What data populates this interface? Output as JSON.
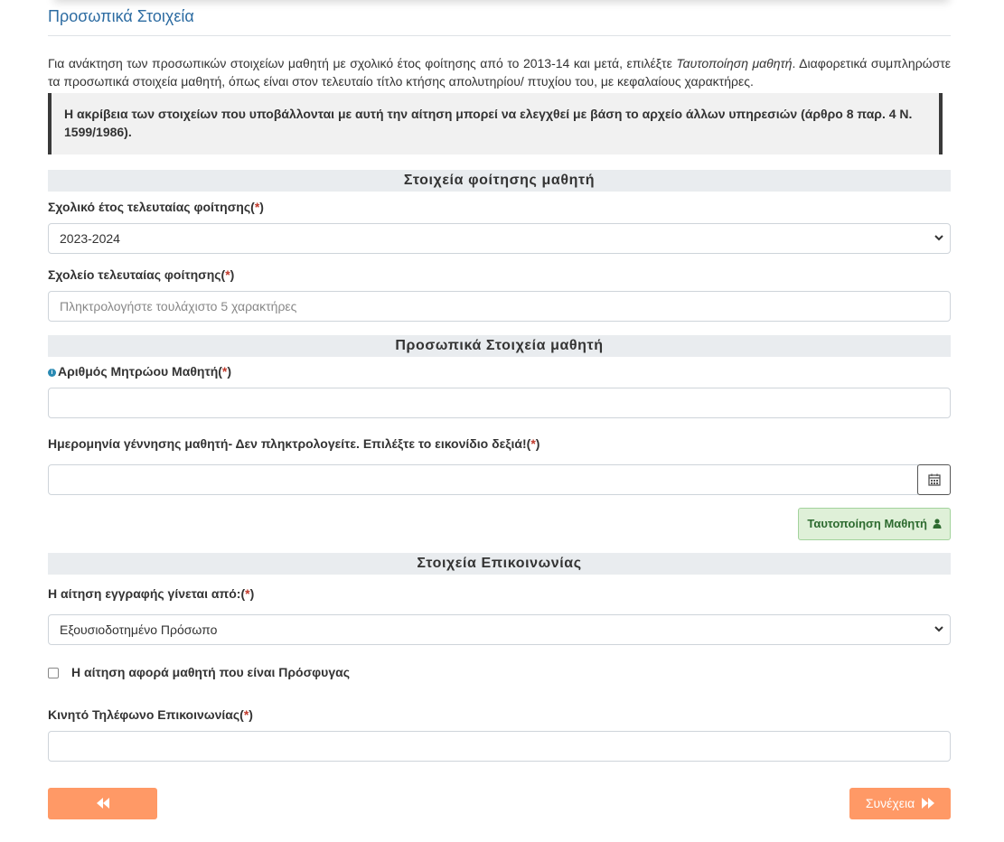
{
  "page": {
    "title": "Προσωπικά Στοιχεία",
    "intro_text_1": "Για ανάκτηση των προσωπικών στοιχείων μαθητή με σχολικό έτος φοίτησης από το 2013-14 και μετά, επιλέξτε ",
    "intro_emphasis": "Ταυτοποίηση μαθητή",
    "intro_text_2": ". Διαφορετικά συμπληρώστε τα προσωπικά στοιχεία μαθητή, όπως είναι στον τελευταίο τίτλο κτήσης απολυτηρίου/ πτυχίου του, με κεφαλαίους χαρακτήρες.",
    "notice": "Η ακρίβεια των στοιχείων που υποβάλλονται με αυτή την αίτηση μπορεί να ελεγχθεί με βάση το αρχείο άλλων υπηρεσιών (άρθρο 8 παρ. 4 Ν. 1599/1986)."
  },
  "attendance": {
    "heading": "Στοιχεία φοίτησης μαθητή",
    "year_label": "Σχολικό έτος τελευταίας φοίτησης",
    "year_value": "2023-2024",
    "school_label": "Σχολείο τελευταίας φοίτησης",
    "school_placeholder": "Πληκτρολογήστε τουλάχιστο 5 χαρακτήρες"
  },
  "personal": {
    "heading": "Προσωπικά Στοιχεία μαθητή",
    "registry_label": "Αριθμός Μητρώου Μαθητή",
    "birthdate_label": "Ημερομηνία γέννησης μαθητή- Δεν πληκτρολογείτε. Επιλέξτε το εικονίδιο δεξιά!",
    "identify_button": "Ταυτοποίηση Μαθητή"
  },
  "contact": {
    "heading": "Στοιχεία Επικοινωνίας",
    "applicant_label": "Η αίτηση εγγραφής γίνεται από:",
    "applicant_value": "Εξουσιοδοτημένο Πρόσωπο",
    "refugee_label": "Η αίτηση αφορά μαθητή που είναι Πρόσφυγας",
    "refugee_checked": false,
    "mobile_label": "Κινητό Τηλέφωνο Επικοινωνίας"
  },
  "common": {
    "required_mark": "*",
    "paren_open": "(",
    "paren_close": ")",
    "info_glyph": "i"
  },
  "nav": {
    "continue_label": "Συνέχεια"
  },
  "colors": {
    "accent_orange": "#ff9966",
    "title_blue": "#2d6ca2",
    "success_green": "#2e6b30"
  }
}
